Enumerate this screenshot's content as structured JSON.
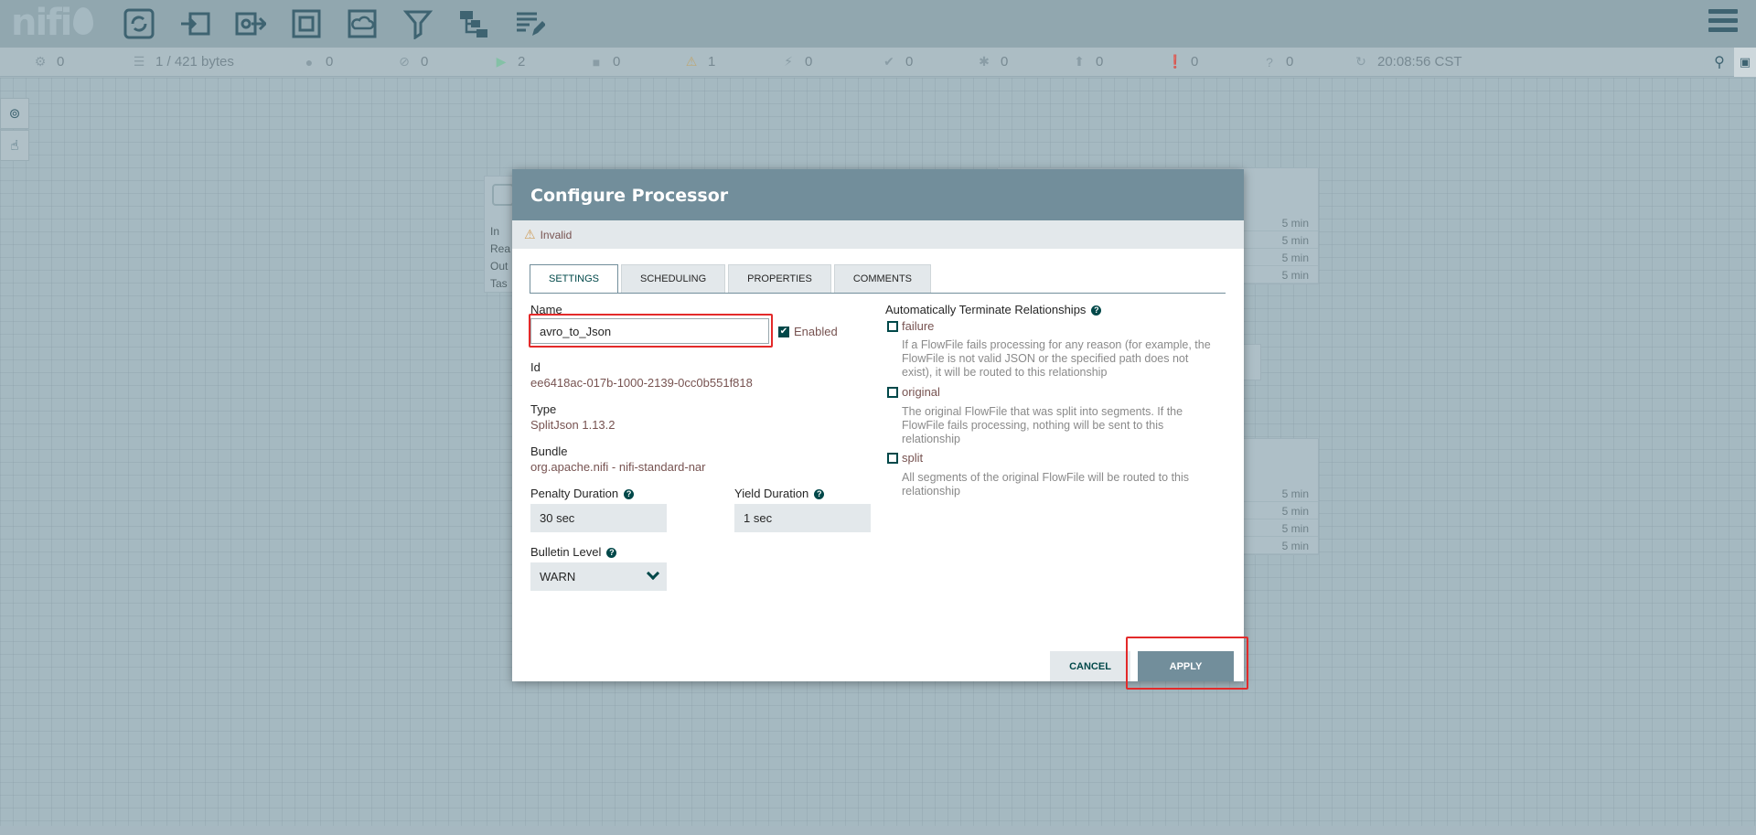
{
  "header": {
    "logo_text": "nifi",
    "tools": [
      {
        "name": "processor-icon"
      },
      {
        "name": "input-port-icon"
      },
      {
        "name": "output-port-icon"
      },
      {
        "name": "process-group-icon"
      },
      {
        "name": "remote-process-group-icon"
      },
      {
        "name": "funnel-icon"
      },
      {
        "name": "template-icon"
      },
      {
        "name": "label-icon"
      }
    ]
  },
  "status": {
    "active_threads": "0",
    "queued": "1 / 421 bytes",
    "transmitting": "0",
    "not_transmitting": "0",
    "running": "2",
    "stopped": "0",
    "invalid": "1",
    "disabled": "0",
    "up_to_date": "0",
    "locally_modified": "0",
    "stale": "0",
    "locally_modified_stale": "0",
    "sync_failure": "0",
    "last_refreshed": "20:08:56 CST"
  },
  "canvas": {
    "proc_left_labels": [
      "In",
      "Rea",
      "Out",
      "Tas"
    ],
    "proc_times": [
      "5 min",
      "5 min",
      "5 min",
      "5 min"
    ]
  },
  "dialog": {
    "title": "Configure Processor",
    "status": "Invalid",
    "tabs": [
      "SETTINGS",
      "SCHEDULING",
      "PROPERTIES",
      "COMMENTS"
    ],
    "name_label": "Name",
    "name_value": "avro_to_Json",
    "enabled_label": "Enabled",
    "id_label": "Id",
    "id_value": "ee6418ac-017b-1000-2139-0cc0b551f818",
    "type_label": "Type",
    "type_value": "SplitJson 1.13.2",
    "bundle_label": "Bundle",
    "bundle_value": "org.apache.nifi - nifi-standard-nar",
    "penalty_label": "Penalty Duration",
    "penalty_value": "30 sec",
    "yield_label": "Yield Duration",
    "yield_value": "1 sec",
    "bulletin_label": "Bulletin Level",
    "bulletin_value": "WARN",
    "auto_term_label": "Automatically Terminate Relationships",
    "relationships": [
      {
        "name": "failure",
        "desc": "If a FlowFile fails processing for any reason (for example, the FlowFile is not valid JSON or the specified path does not exist), it will be routed to this relationship"
      },
      {
        "name": "original",
        "desc": "The original FlowFile that was split into segments. If the FlowFile fails processing, nothing will be sent to this relationship"
      },
      {
        "name": "split",
        "desc": "All segments of the original FlowFile will be routed to this relationship"
      }
    ],
    "cancel_label": "CANCEL",
    "apply_label": "APPLY"
  },
  "colors": {
    "header_bg": "#728e9b",
    "accent": "#004849",
    "value_text": "#775351",
    "highlight": "#e32a2a",
    "warning": "#cf9f5d"
  }
}
